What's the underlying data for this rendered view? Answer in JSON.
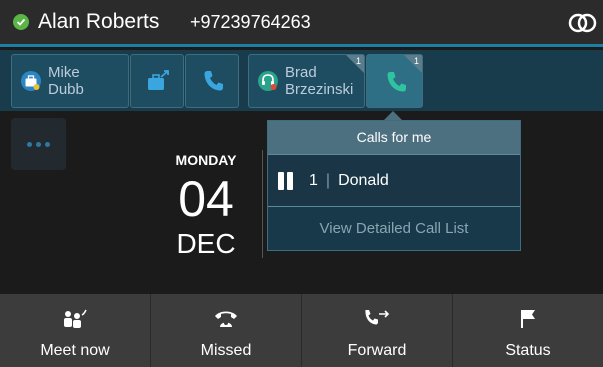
{
  "header": {
    "user_name": "Alan Roberts",
    "user_number": "+97239764263",
    "presence": "available",
    "presence_color": "#5bb446",
    "accent_color": "#1b7fa6"
  },
  "speed_dials": [
    {
      "type": "contact",
      "label_line1": "Mike",
      "label_line2": "Dubb",
      "icon": "contact-briefcase-icon"
    },
    {
      "type": "action",
      "icon": "transfer-briefcase-icon"
    },
    {
      "type": "action",
      "icon": "phone-call-icon"
    },
    {
      "type": "contact",
      "label_line1": "Brad",
      "label_line2": "Brzezinski",
      "icon": "headset-icon",
      "badge": "1"
    },
    {
      "type": "action",
      "icon": "phone-call-icon",
      "badge": "1"
    }
  ],
  "date": {
    "day": "MONDAY",
    "date_num": "04",
    "month": "DEC"
  },
  "calls_popup": {
    "title": "Calls for me",
    "calls": [
      {
        "index": "1",
        "name": "Donald",
        "state": "hold"
      }
    ],
    "footer": "View Detailed Call List"
  },
  "softkeys": [
    {
      "label": "Meet now",
      "icon": "meet-now-icon"
    },
    {
      "label": "Missed",
      "icon": "missed-call-icon"
    },
    {
      "label": "Forward",
      "icon": "forward-icon"
    },
    {
      "label": "Status",
      "icon": "flag-icon"
    }
  ]
}
